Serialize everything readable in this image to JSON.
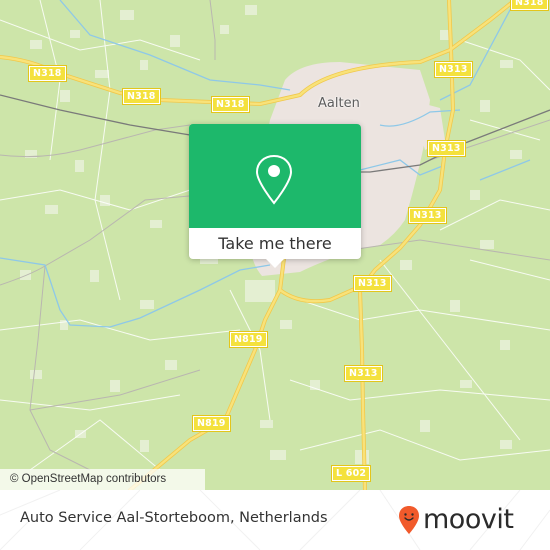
{
  "map": {
    "place_label": "Aalten",
    "road_labels": [
      {
        "id": "n318-a",
        "text": "N318"
      },
      {
        "id": "n318-b",
        "text": "N318"
      },
      {
        "id": "n318-c",
        "text": "N318"
      },
      {
        "id": "n318-d",
        "text": "N318"
      },
      {
        "id": "n313-a",
        "text": "N313"
      },
      {
        "id": "n313-b",
        "text": "N313"
      },
      {
        "id": "n313-c",
        "text": "N313"
      },
      {
        "id": "n313-d",
        "text": "N313"
      },
      {
        "id": "n313-e",
        "text": "N313"
      },
      {
        "id": "n819-a",
        "text": "N819"
      },
      {
        "id": "n819-b",
        "text": "N819"
      },
      {
        "id": "l602",
        "text": "L 602"
      }
    ],
    "attribution": "© OpenStreetMap contributors",
    "colors": {
      "land": "#cde5a9",
      "urban": "#ece4e0",
      "road_major": "#f4d85a",
      "water": "#8ec8e8",
      "rail": "#7a7a7a"
    }
  },
  "popup": {
    "icon": "location-pin-icon",
    "button_label": "Take me there",
    "accent_color": "#1db86b"
  },
  "footer": {
    "place_name": "Auto Service Aal-Storteboom, Netherlands",
    "brand": "moovit",
    "brand_icon": "moovit-smiley-pin-icon",
    "brand_color": "#f15a2b"
  }
}
